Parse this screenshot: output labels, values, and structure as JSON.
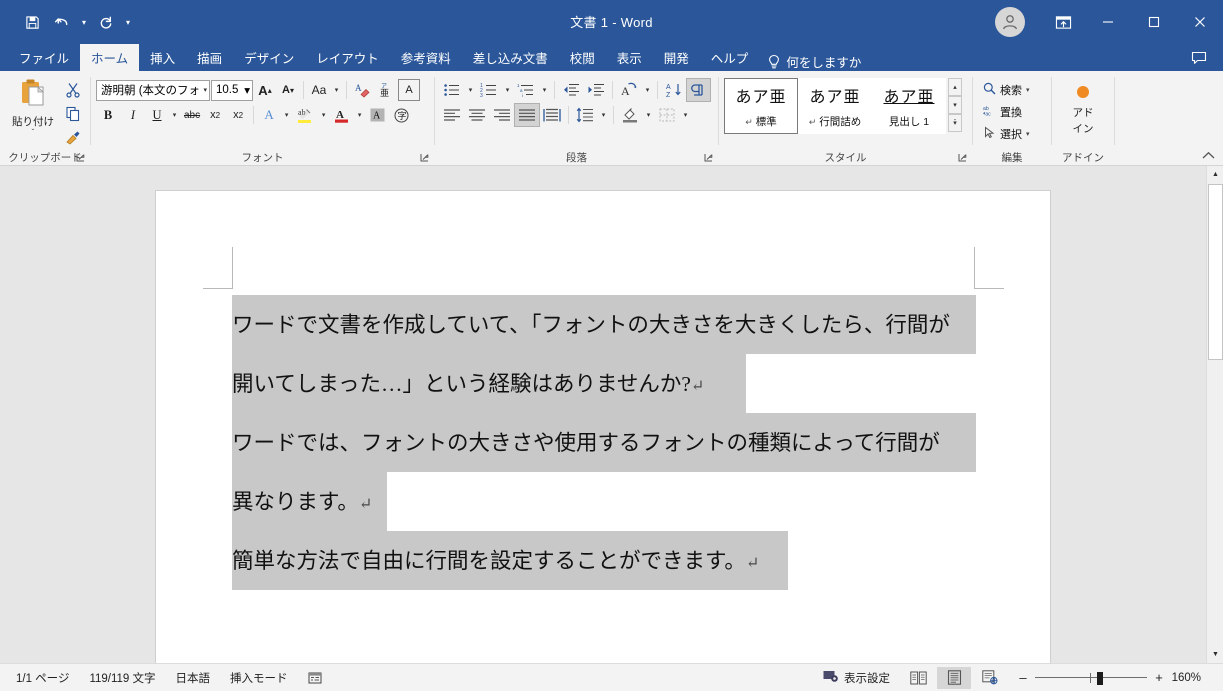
{
  "window": {
    "title": "文書 1  -  Word",
    "quick_access": [
      {
        "name": "save",
        "icon": "save-icon"
      },
      {
        "name": "undo",
        "icon": "undo-icon"
      },
      {
        "name": "redo",
        "icon": "redo-icon"
      },
      {
        "name": "customize",
        "icon": "chevron-down-icon"
      }
    ],
    "controls": {
      "account": "account-avatar",
      "ribbon_display": "ribbon-display-options-icon",
      "minimize": "–",
      "maximize": "☐",
      "close": "✕"
    }
  },
  "tabs": [
    {
      "label": "ファイル",
      "active": false
    },
    {
      "label": "ホーム",
      "active": true
    },
    {
      "label": "挿入",
      "active": false
    },
    {
      "label": "描画",
      "active": false
    },
    {
      "label": "デザイン",
      "active": false
    },
    {
      "label": "レイアウト",
      "active": false
    },
    {
      "label": "参考資料",
      "active": false
    },
    {
      "label": "差し込み文書",
      "active": false
    },
    {
      "label": "校閲",
      "active": false
    },
    {
      "label": "表示",
      "active": false
    },
    {
      "label": "開発",
      "active": false
    },
    {
      "label": "ヘルプ",
      "active": false
    }
  ],
  "tell_me": {
    "label": "何をしますか",
    "icon": "lightbulb-icon"
  },
  "ribbon": {
    "clipboard": {
      "label": "クリップボード",
      "paste": {
        "label": "貼り付け",
        "icon": "paste-icon",
        "dropdown": "ˇ"
      },
      "cut": {
        "name": "cut",
        "icon": "scissors-icon"
      },
      "copy": {
        "name": "copy",
        "icon": "copy-icon"
      },
      "format_painter": {
        "name": "format-painter",
        "icon": "paintbrush-icon"
      },
      "dialog_launcher": "↘"
    },
    "font": {
      "label": "フォント",
      "font_name": "游明朝 (本文のフォン",
      "font_size": "10.5",
      "grow_font": "A",
      "shrink_font": "A",
      "change_case": "Aa",
      "clear_formatting": "clear-format-icon",
      "phonetic_guide": "phonetic-guide-icon",
      "character_border": "A",
      "bold": "B",
      "italic": "I",
      "underline": "U",
      "strikethrough": "abc",
      "subscript": "x₂",
      "superscript": "x²",
      "text_effects": "A",
      "text_highlight": "text-highlight-icon",
      "font_color": "A",
      "character_shading": "A",
      "enclose_characters": "㍓",
      "dialog_launcher": "↘"
    },
    "paragraph": {
      "label": "段落",
      "bullets": "bullet-list-icon",
      "numbering": "numbered-list-icon",
      "multilevel": "multilevel-list-icon",
      "decrease_indent": "decrease-indent-icon",
      "increase_indent": "increase-indent-icon",
      "asian_layout": "asian-layout-icon",
      "sort": "sort-icon",
      "show_marks": "show-paragraph-marks-icon",
      "align_left": "align-left-icon",
      "align_center": "align-center-icon",
      "align_right": "align-right-icon",
      "justify": "justify-icon",
      "distribute": "distribute-icon",
      "line_spacing": "line-spacing-icon",
      "shading": "shading-icon",
      "borders": "borders-icon",
      "dialog_launcher": "↘"
    },
    "styles": {
      "label": "スタイル",
      "items": [
        {
          "sample": "あア亜",
          "name": "標準",
          "pilcrow": "↵",
          "selected": true
        },
        {
          "sample": "あア亜",
          "name": "行間詰め",
          "pilcrow": "↵",
          "selected": false
        },
        {
          "sample": "あア亜",
          "name": "見出し 1",
          "pilcrow": "",
          "selected": false
        }
      ],
      "scroll_up": "▴",
      "scroll_down": "▾",
      "more": "⨍",
      "dialog_launcher": "↘"
    },
    "editing": {
      "label": "編集",
      "find": {
        "label": "検索",
        "icon": "search-icon",
        "caret": "ˇ"
      },
      "replace": {
        "label": "置換",
        "icon": "replace-icon"
      },
      "select": {
        "label": "選択",
        "icon": "cursor-select-icon",
        "caret": "ˇ"
      }
    },
    "addins": {
      "label": "アドイン",
      "button": {
        "label_line1": "アド",
        "label_line2": "イン",
        "icon": "addin-dot-icon"
      }
    },
    "collapse": "˄"
  },
  "document": {
    "paragraphs": [
      {
        "lines": [
          {
            "text": "ワードで文書を作成していて、「フォントの大きさを大きくしたら、行間が",
            "pilcrow": "",
            "highlight_width": 744
          },
          {
            "text": "開いてしまった…」という経験はありませんか?",
            "pilcrow": "↵",
            "highlight_width": 514
          }
        ]
      },
      {
        "lines": [
          {
            "text": "ワードでは、フォントの大きさや使用するフォントの種類によって行間が",
            "pilcrow": "",
            "highlight_width": 744
          },
          {
            "text": "異なります。",
            "pilcrow": "↵",
            "highlight_width": 155
          }
        ]
      },
      {
        "lines": [
          {
            "text": "簡単な方法で自由に行間を設定することができます。",
            "pilcrow": "↵",
            "highlight_width": 556
          }
        ]
      }
    ]
  },
  "status_bar": {
    "page": "1/1 ページ",
    "words": "119/119 文字",
    "language": "日本語",
    "mode": "挿入モード",
    "proofing_icon": "proofing-icon",
    "display_settings": {
      "label": "表示設定",
      "icon": "display-settings-icon"
    },
    "views": [
      {
        "name": "read-mode",
        "icon": "read-mode-icon",
        "active": false
      },
      {
        "name": "print-layout",
        "icon": "print-layout-icon",
        "active": true
      },
      {
        "name": "web-layout",
        "icon": "web-layout-icon",
        "active": false
      }
    ],
    "zoom": {
      "minus": "–",
      "plus": "+",
      "percent": "160%",
      "value": 160
    }
  },
  "scrollbar": {
    "up": "▲",
    "down": "▼"
  }
}
